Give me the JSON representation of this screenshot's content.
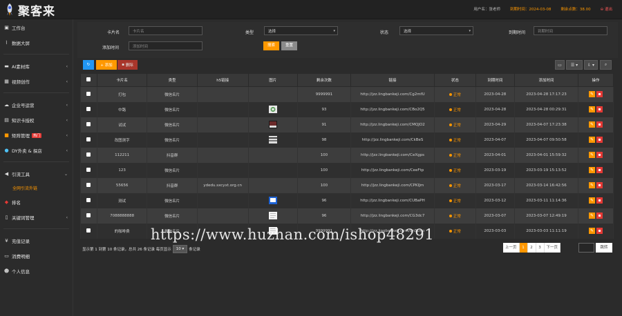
{
  "app": {
    "logo_text": "聚客来"
  },
  "header": {
    "user_label": "用户名：张老师",
    "expire_label": "到期时间：",
    "expire_value": "2024-03-08",
    "balance_label": "剩余点数：",
    "balance_value": "38.00",
    "logout_label": "退出"
  },
  "sidebar": {
    "items": [
      {
        "label": "工作台",
        "icon": "monitor-icon"
      },
      {
        "label": "数据大屏",
        "icon": "chart-icon"
      },
      {
        "label": "AI素材库",
        "icon": "folder-icon"
      },
      {
        "label": "视频创作",
        "icon": "film-icon"
      },
      {
        "label": "企业号运营",
        "icon": "cloud-icon"
      },
      {
        "label": "知识卡授权",
        "icon": "card-icon"
      },
      {
        "label": "矩阵管理",
        "icon": "grid-icon",
        "badge": "热门"
      },
      {
        "label": "DY外卖 & 探店",
        "icon": "shop-icon"
      },
      {
        "label": "引流工具",
        "icon": "magnet-icon"
      },
      {
        "label": "排名",
        "icon": "rank-icon"
      },
      {
        "label": "关键词管理",
        "icon": "doc-icon"
      },
      {
        "label": "充值记录",
        "icon": "yen-icon"
      },
      {
        "label": "消费明细",
        "icon": "list-icon"
      },
      {
        "label": "个人信息",
        "icon": "user-icon"
      }
    ],
    "sub_item": "全网引流外链"
  },
  "filters": {
    "card_name_label": "卡片名",
    "card_name_placeholder": "卡片名",
    "type_label": "类型",
    "type_value": "选择",
    "status_label": "状态",
    "status_value": "选择",
    "expire_label": "到期时间",
    "expire_placeholder": "到期时间",
    "add_time_label": "添加时间",
    "add_time_placeholder": "添加时间",
    "search_button": "搜索",
    "reset_button": "重置"
  },
  "toolbar": {
    "add_label": "+ 添加",
    "delete_label": "删除"
  },
  "table": {
    "headers": [
      "卡片名",
      "类型",
      "h5链接",
      "图片",
      "剩余次数",
      "链接",
      "状态",
      "到期时间",
      "添加时间",
      "操作"
    ],
    "rows": [
      {
        "name": "打包",
        "type": "微信名片",
        "h5": "",
        "img": "none",
        "count": "9999991",
        "link": "http://jzz.lingbankeji.com/Cg2mfU",
        "status": "正常",
        "expire": "2023-04-28",
        "added": "2023-04-28 17:17:23"
      },
      {
        "name": "中路",
        "type": "微信名片",
        "h5": "",
        "img": "qr",
        "count": "93",
        "link": "http://jzz.lingbankeji.com/CBo2Q5",
        "status": "正常",
        "expire": "2023-04-28",
        "added": "2023-04-28 00:29:31"
      },
      {
        "name": "试试",
        "type": "微信名片",
        "h5": "",
        "img": "photo",
        "count": "91",
        "link": "http://jzz.lingbankeji.com/CMQJO2",
        "status": "正常",
        "expire": "2023-04-29",
        "added": "2023-04-07 17:23:38"
      },
      {
        "name": "改图测字",
        "type": "微信名片",
        "h5": "",
        "img": "screen",
        "count": "98",
        "link": "http://jzz.lingbankeji.com/CkBeS",
        "status": "正常",
        "expire": "2023-04-07",
        "added": "2023-04-07 09:50:58"
      },
      {
        "name": "112211",
        "type": "抖音群",
        "h5": "",
        "img": "none",
        "count": "100",
        "link": "http://jzz.lingbankeji.com/CeXgps",
        "status": "正常",
        "expire": "2023-04-01",
        "added": "2023-04-01 15:59:32"
      },
      {
        "name": "123",
        "type": "微信名片",
        "h5": "",
        "img": "none",
        "count": "100",
        "link": "http://jzz.lingbankeji.com/CeeFtp",
        "status": "正常",
        "expire": "2023-03-19",
        "added": "2023-03-19 15:13:52"
      },
      {
        "name": "55656",
        "type": "抖音群",
        "h5": "ydedu.sxcyxt.org.cn",
        "img": "none",
        "count": "100",
        "link": "http://jzz.lingbankeji.com/CPKIJm",
        "status": "正常",
        "expire": "2023-03-17",
        "added": "2023-03-14 16:42:56"
      },
      {
        "name": "测试",
        "type": "微信名片",
        "h5": "",
        "img": "blue",
        "count": "96",
        "link": "http://jzz.lingbankeji.com/CUBaPH",
        "status": "正常",
        "expire": "2023-03-12",
        "added": "2023-03-11 11:14:36"
      },
      {
        "name": "7088888888",
        "type": "微信名片",
        "h5": "",
        "img": "doc",
        "count": "96",
        "link": "http://jzz.lingbankeji.com/CG3dc7",
        "status": "正常",
        "expire": "2023-03-07",
        "added": "2023-03-07 12:49:19"
      },
      {
        "name": "的咖啡费",
        "type": "微信名片",
        "h5": "",
        "img": "doc",
        "count": "9999991",
        "link": "http://jzz.lingbankeji.com/Cn5Uno",
        "status": "正常",
        "expire": "2023-03-03",
        "added": "2023-03-03 11:11:19"
      }
    ]
  },
  "footer": {
    "info_prefix": "显示第 1 到第 10 条记录，总共 26 条记录 每页显示",
    "page_size": "10",
    "info_suffix": "条记录",
    "prev": "上一页",
    "pages": [
      "1",
      "2",
      "3"
    ],
    "next": "下一页",
    "jump": "跳转"
  },
  "watermark": "https://www.huzhan.com/ishop48291",
  "colors": {
    "accent": "#ff9800",
    "danger": "#e53935",
    "primary": "#2196f3"
  }
}
